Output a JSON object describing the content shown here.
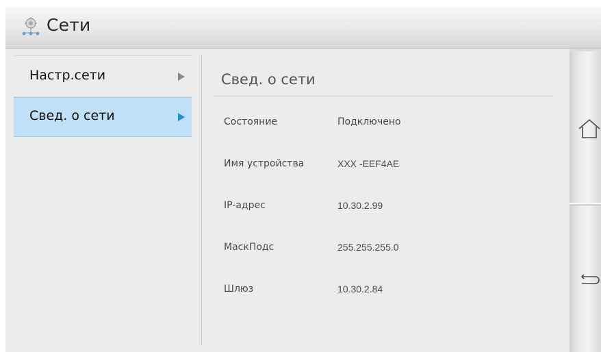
{
  "header": {
    "title": "Сети",
    "icon": "network-settings-icon"
  },
  "menu": {
    "items": [
      {
        "label": "Настр.сети",
        "selected": false
      },
      {
        "label": "Свед. о сети",
        "selected": true
      }
    ],
    "selected_color": "#bfe0f6",
    "selected_arrow_color": "#1f8fd6"
  },
  "content": {
    "title": "Свед. о сети",
    "rows": [
      {
        "label": "Состояние",
        "value": "Подключено"
      },
      {
        "label": "Имя устройства",
        "value": "XXX -EEF4AE"
      },
      {
        "label": "IP-адрес",
        "value": "10.30.2.99"
      },
      {
        "label": "МаскПодс",
        "value": "255.255.255.0"
      },
      {
        "label": "Шлюз",
        "value": "10.30.2.84"
      }
    ]
  },
  "sidebar": {
    "buttons": [
      {
        "icon": "home-icon"
      },
      {
        "icon": "back-icon"
      }
    ]
  }
}
